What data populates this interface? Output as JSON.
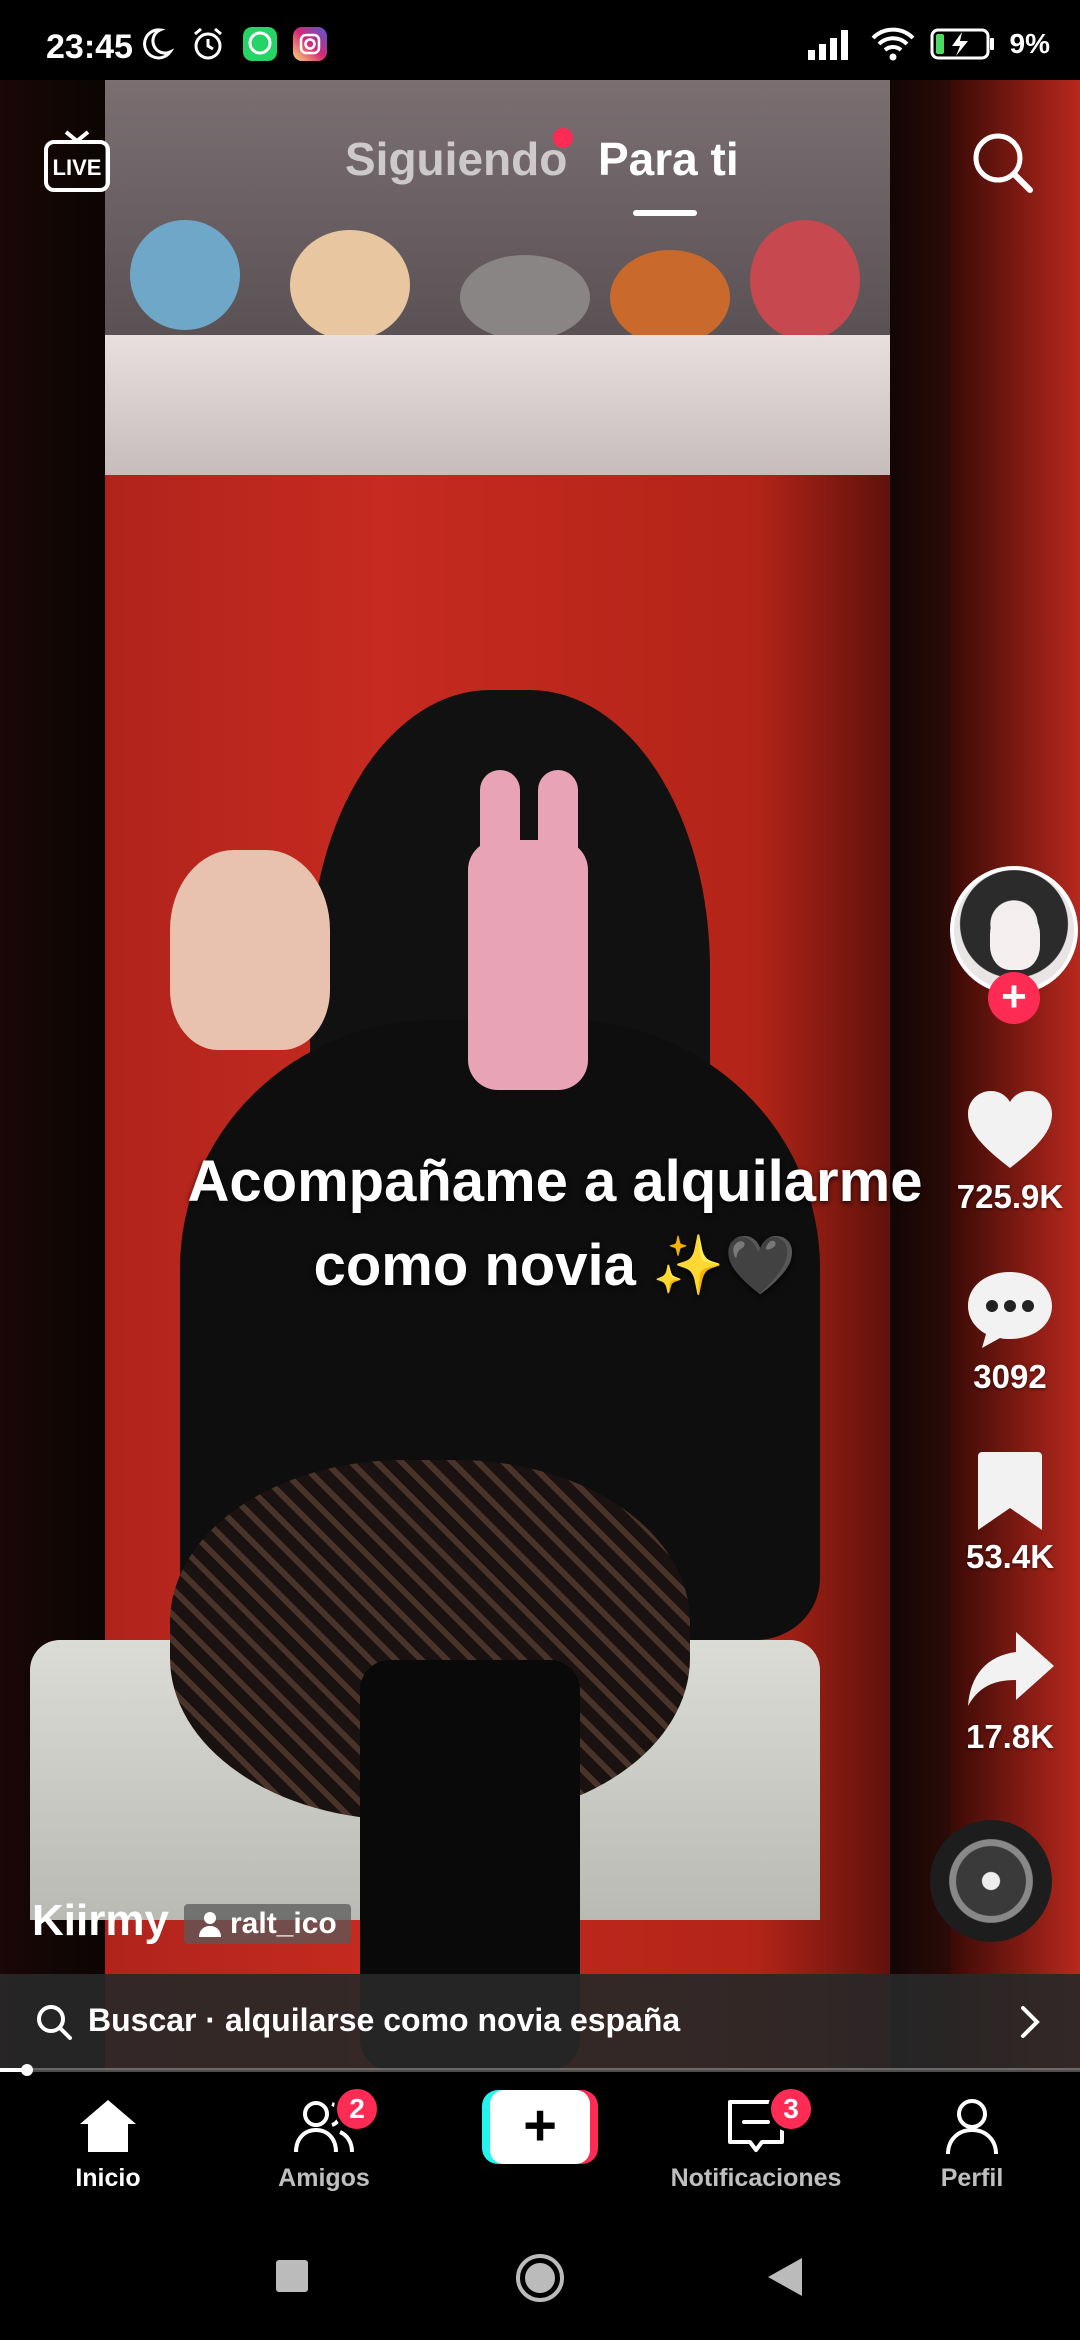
{
  "status_bar": {
    "time": "23:45",
    "battery_percent": "9%",
    "icons": [
      "moon-icon",
      "alarm-icon",
      "whatsapp-icon",
      "instagram-icon",
      "signal-icon",
      "wifi-icon",
      "battery-charging-icon"
    ]
  },
  "top_nav": {
    "live_label": "LIVE",
    "tabs": [
      {
        "label": "Siguiendo",
        "active": false,
        "has_dot": true
      },
      {
        "label": "Para ti",
        "active": true
      }
    ]
  },
  "video": {
    "caption_line1": "Acompañame a alquilarme",
    "caption_line2": "como novia ✨🖤"
  },
  "actions": {
    "likes": "725.9K",
    "comments": "3092",
    "saves": "53.4K",
    "shares": "17.8K"
  },
  "author": {
    "name": "Kiirmy",
    "tag": "ralt_ico"
  },
  "suggestion": {
    "text": "Buscar · alquilarse como novia españa"
  },
  "progress": {
    "fraction": 0.025
  },
  "bottom_nav": {
    "items": [
      {
        "label": "Inicio",
        "active": true
      },
      {
        "label": "Amigos",
        "badge": "2"
      },
      {
        "label": "",
        "create": true
      },
      {
        "label": "Notificaciones",
        "badge": "3"
      },
      {
        "label": "Perfil"
      }
    ]
  },
  "colors": {
    "accent": "#fe2c55",
    "cyan": "#25f4ee",
    "background": "#000000"
  }
}
